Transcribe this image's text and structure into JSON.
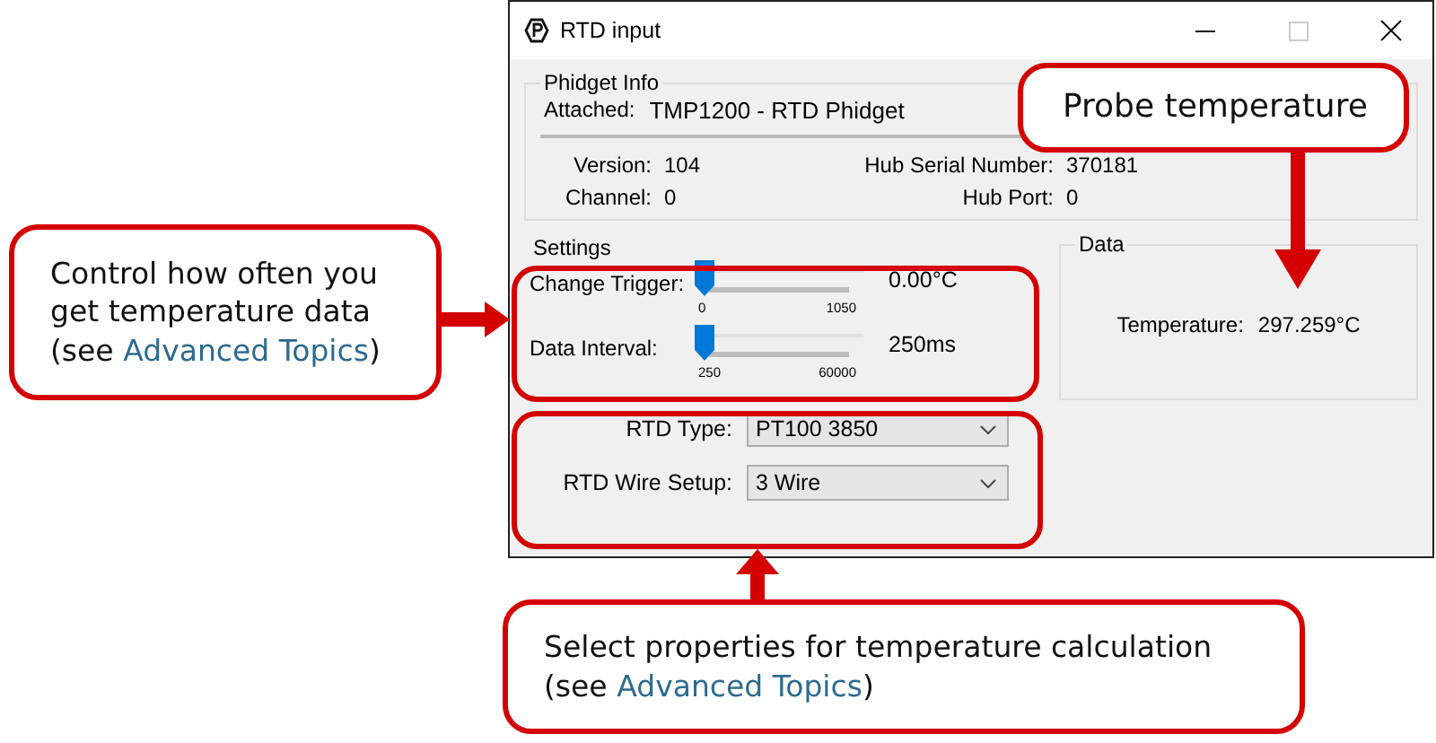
{
  "window": {
    "title": "RTD input"
  },
  "phidget_info": {
    "title": "Phidget Info",
    "attached_label": "Attached:",
    "attached_value": "TMP1200 - RTD Phidget",
    "fields": [
      {
        "label": "Version:",
        "value": "104"
      },
      {
        "label": "Hub Serial Number:",
        "value": "370181"
      },
      {
        "label": "Channel:",
        "value": "0"
      },
      {
        "label": "Hub Port:",
        "value": "0"
      }
    ]
  },
  "settings": {
    "title": "Settings",
    "sliders": [
      {
        "label": "Change Trigger:",
        "level": 0,
        "min": "0",
        "max": "1050",
        "reading": "0.00°C"
      },
      {
        "label": "Data Interval:",
        "level": 0,
        "min": "250",
        "max": "60000",
        "reading": "250ms"
      }
    ]
  },
  "rtd": [
    {
      "label": "RTD Type:",
      "value": "PT100 3850"
    },
    {
      "label": "RTD Wire Setup:",
      "value": "3 Wire"
    }
  ],
  "data": {
    "title": "Data",
    "label": "Temperature:",
    "value": "297.259°C"
  },
  "callouts": [
    {
      "text": "Control how often you get temperature data",
      "see": "(see",
      "link": "Advanced Topics",
      "close": ")"
    },
    {
      "text": "Probe temperature"
    },
    {
      "text": "Select properties for temperature calculation",
      "see": "(see",
      "link": "Advanced Topics",
      "close": ")"
    }
  ]
}
